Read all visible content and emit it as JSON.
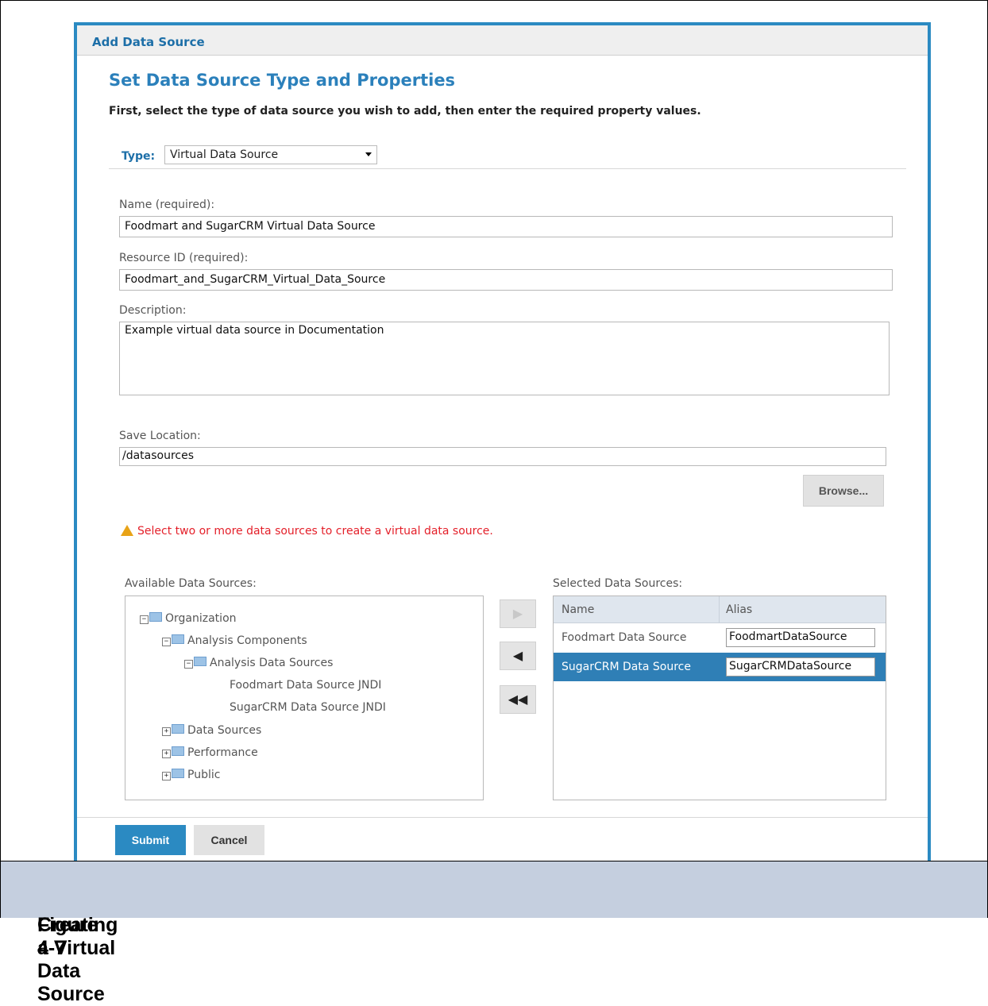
{
  "dialog": {
    "header": "Add Data Source",
    "heading": "Set Data Source Type and Properties",
    "intro": "First, select the type of data source you wish to add, then enter the required property values."
  },
  "type": {
    "label": "Type:",
    "value": "Virtual Data Source"
  },
  "fields": {
    "name_label": "Name (required):",
    "name_value": "Foodmart and SugarCRM Virtual Data Source",
    "resource_label": "Resource ID (required):",
    "resource_value": "Foodmart_and_SugarCRM_Virtual_Data_Source",
    "description_label": "Description:",
    "description_value": "Example virtual data source in Documentation",
    "save_label": "Save Location:",
    "save_value": "/datasources",
    "browse_label": "Browse..."
  },
  "warning": "Select two or more data sources to create a virtual data source.",
  "available": {
    "label": "Available Data Sources:",
    "tree": [
      {
        "label": "Organization",
        "expanded": true,
        "folder": true
      },
      {
        "label": "Analysis Components",
        "expanded": true,
        "folder": true
      },
      {
        "label": "Analysis Data Sources",
        "expanded": true,
        "folder": true
      },
      {
        "label": "Foodmart Data Source JNDI",
        "folder": false
      },
      {
        "label": "SugarCRM Data Source JNDI",
        "folder": false
      },
      {
        "label": "Data Sources",
        "expanded": false,
        "folder": true
      },
      {
        "label": "Performance",
        "expanded": false,
        "folder": true
      },
      {
        "label": "Public",
        "expanded": false,
        "folder": true
      }
    ]
  },
  "selected": {
    "label": "Selected Data Sources:",
    "col_name": "Name",
    "col_alias": "Alias",
    "rows": [
      {
        "name": "Foodmart Data Source",
        "alias": "FoodmartDataSource",
        "selected": false
      },
      {
        "name": "SugarCRM Data Source",
        "alias": "SugarCRMDataSource",
        "selected": true
      }
    ]
  },
  "buttons": {
    "submit": "Submit",
    "cancel": "Cancel"
  },
  "caption": {
    "figure": "Figure 4-7",
    "title": "Creating a Virtual Data Source"
  },
  "colors": {
    "accent": "#2b8ac2",
    "warning": "#e4202a",
    "caption_bg": "#c5cfdf"
  }
}
